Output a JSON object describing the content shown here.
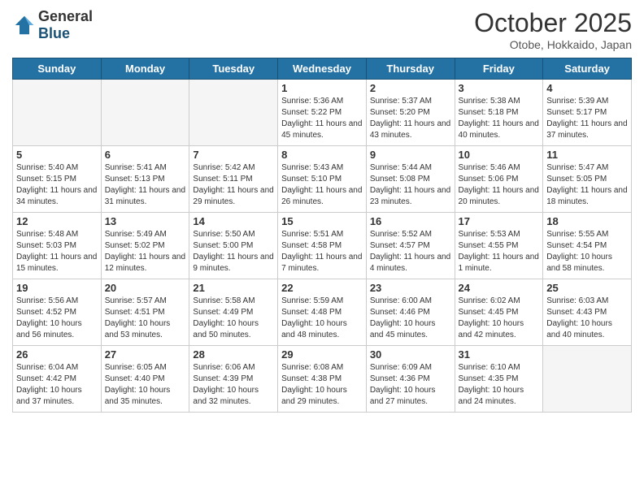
{
  "header": {
    "logo_general": "General",
    "logo_blue": "Blue",
    "month_title": "October 2025",
    "subtitle": "Otobe, Hokkaido, Japan"
  },
  "weekdays": [
    "Sunday",
    "Monday",
    "Tuesday",
    "Wednesday",
    "Thursday",
    "Friday",
    "Saturday"
  ],
  "weeks": [
    [
      {
        "day": "",
        "sunrise": "",
        "sunset": "",
        "daylight": "",
        "empty": true
      },
      {
        "day": "",
        "sunrise": "",
        "sunset": "",
        "daylight": "",
        "empty": true
      },
      {
        "day": "",
        "sunrise": "",
        "sunset": "",
        "daylight": "",
        "empty": true
      },
      {
        "day": "1",
        "sunrise": "Sunrise: 5:36 AM",
        "sunset": "Sunset: 5:22 PM",
        "daylight": "Daylight: 11 hours and 45 minutes.",
        "empty": false
      },
      {
        "day": "2",
        "sunrise": "Sunrise: 5:37 AM",
        "sunset": "Sunset: 5:20 PM",
        "daylight": "Daylight: 11 hours and 43 minutes.",
        "empty": false
      },
      {
        "day": "3",
        "sunrise": "Sunrise: 5:38 AM",
        "sunset": "Sunset: 5:18 PM",
        "daylight": "Daylight: 11 hours and 40 minutes.",
        "empty": false
      },
      {
        "day": "4",
        "sunrise": "Sunrise: 5:39 AM",
        "sunset": "Sunset: 5:17 PM",
        "daylight": "Daylight: 11 hours and 37 minutes.",
        "empty": false
      }
    ],
    [
      {
        "day": "5",
        "sunrise": "Sunrise: 5:40 AM",
        "sunset": "Sunset: 5:15 PM",
        "daylight": "Daylight: 11 hours and 34 minutes.",
        "empty": false
      },
      {
        "day": "6",
        "sunrise": "Sunrise: 5:41 AM",
        "sunset": "Sunset: 5:13 PM",
        "daylight": "Daylight: 11 hours and 31 minutes.",
        "empty": false
      },
      {
        "day": "7",
        "sunrise": "Sunrise: 5:42 AM",
        "sunset": "Sunset: 5:11 PM",
        "daylight": "Daylight: 11 hours and 29 minutes.",
        "empty": false
      },
      {
        "day": "8",
        "sunrise": "Sunrise: 5:43 AM",
        "sunset": "Sunset: 5:10 PM",
        "daylight": "Daylight: 11 hours and 26 minutes.",
        "empty": false
      },
      {
        "day": "9",
        "sunrise": "Sunrise: 5:44 AM",
        "sunset": "Sunset: 5:08 PM",
        "daylight": "Daylight: 11 hours and 23 minutes.",
        "empty": false
      },
      {
        "day": "10",
        "sunrise": "Sunrise: 5:46 AM",
        "sunset": "Sunset: 5:06 PM",
        "daylight": "Daylight: 11 hours and 20 minutes.",
        "empty": false
      },
      {
        "day": "11",
        "sunrise": "Sunrise: 5:47 AM",
        "sunset": "Sunset: 5:05 PM",
        "daylight": "Daylight: 11 hours and 18 minutes.",
        "empty": false
      }
    ],
    [
      {
        "day": "12",
        "sunrise": "Sunrise: 5:48 AM",
        "sunset": "Sunset: 5:03 PM",
        "daylight": "Daylight: 11 hours and 15 minutes.",
        "empty": false
      },
      {
        "day": "13",
        "sunrise": "Sunrise: 5:49 AM",
        "sunset": "Sunset: 5:02 PM",
        "daylight": "Daylight: 11 hours and 12 minutes.",
        "empty": false
      },
      {
        "day": "14",
        "sunrise": "Sunrise: 5:50 AM",
        "sunset": "Sunset: 5:00 PM",
        "daylight": "Daylight: 11 hours and 9 minutes.",
        "empty": false
      },
      {
        "day": "15",
        "sunrise": "Sunrise: 5:51 AM",
        "sunset": "Sunset: 4:58 PM",
        "daylight": "Daylight: 11 hours and 7 minutes.",
        "empty": false
      },
      {
        "day": "16",
        "sunrise": "Sunrise: 5:52 AM",
        "sunset": "Sunset: 4:57 PM",
        "daylight": "Daylight: 11 hours and 4 minutes.",
        "empty": false
      },
      {
        "day": "17",
        "sunrise": "Sunrise: 5:53 AM",
        "sunset": "Sunset: 4:55 PM",
        "daylight": "Daylight: 11 hours and 1 minute.",
        "empty": false
      },
      {
        "day": "18",
        "sunrise": "Sunrise: 5:55 AM",
        "sunset": "Sunset: 4:54 PM",
        "daylight": "Daylight: 10 hours and 58 minutes.",
        "empty": false
      }
    ],
    [
      {
        "day": "19",
        "sunrise": "Sunrise: 5:56 AM",
        "sunset": "Sunset: 4:52 PM",
        "daylight": "Daylight: 10 hours and 56 minutes.",
        "empty": false
      },
      {
        "day": "20",
        "sunrise": "Sunrise: 5:57 AM",
        "sunset": "Sunset: 4:51 PM",
        "daylight": "Daylight: 10 hours and 53 minutes.",
        "empty": false
      },
      {
        "day": "21",
        "sunrise": "Sunrise: 5:58 AM",
        "sunset": "Sunset: 4:49 PM",
        "daylight": "Daylight: 10 hours and 50 minutes.",
        "empty": false
      },
      {
        "day": "22",
        "sunrise": "Sunrise: 5:59 AM",
        "sunset": "Sunset: 4:48 PM",
        "daylight": "Daylight: 10 hours and 48 minutes.",
        "empty": false
      },
      {
        "day": "23",
        "sunrise": "Sunrise: 6:00 AM",
        "sunset": "Sunset: 4:46 PM",
        "daylight": "Daylight: 10 hours and 45 minutes.",
        "empty": false
      },
      {
        "day": "24",
        "sunrise": "Sunrise: 6:02 AM",
        "sunset": "Sunset: 4:45 PM",
        "daylight": "Daylight: 10 hours and 42 minutes.",
        "empty": false
      },
      {
        "day": "25",
        "sunrise": "Sunrise: 6:03 AM",
        "sunset": "Sunset: 4:43 PM",
        "daylight": "Daylight: 10 hours and 40 minutes.",
        "empty": false
      }
    ],
    [
      {
        "day": "26",
        "sunrise": "Sunrise: 6:04 AM",
        "sunset": "Sunset: 4:42 PM",
        "daylight": "Daylight: 10 hours and 37 minutes.",
        "empty": false
      },
      {
        "day": "27",
        "sunrise": "Sunrise: 6:05 AM",
        "sunset": "Sunset: 4:40 PM",
        "daylight": "Daylight: 10 hours and 35 minutes.",
        "empty": false
      },
      {
        "day": "28",
        "sunrise": "Sunrise: 6:06 AM",
        "sunset": "Sunset: 4:39 PM",
        "daylight": "Daylight: 10 hours and 32 minutes.",
        "empty": false
      },
      {
        "day": "29",
        "sunrise": "Sunrise: 6:08 AM",
        "sunset": "Sunset: 4:38 PM",
        "daylight": "Daylight: 10 hours and 29 minutes.",
        "empty": false
      },
      {
        "day": "30",
        "sunrise": "Sunrise: 6:09 AM",
        "sunset": "Sunset: 4:36 PM",
        "daylight": "Daylight: 10 hours and 27 minutes.",
        "empty": false
      },
      {
        "day": "31",
        "sunrise": "Sunrise: 6:10 AM",
        "sunset": "Sunset: 4:35 PM",
        "daylight": "Daylight: 10 hours and 24 minutes.",
        "empty": false
      },
      {
        "day": "",
        "sunrise": "",
        "sunset": "",
        "daylight": "",
        "empty": true
      }
    ]
  ]
}
